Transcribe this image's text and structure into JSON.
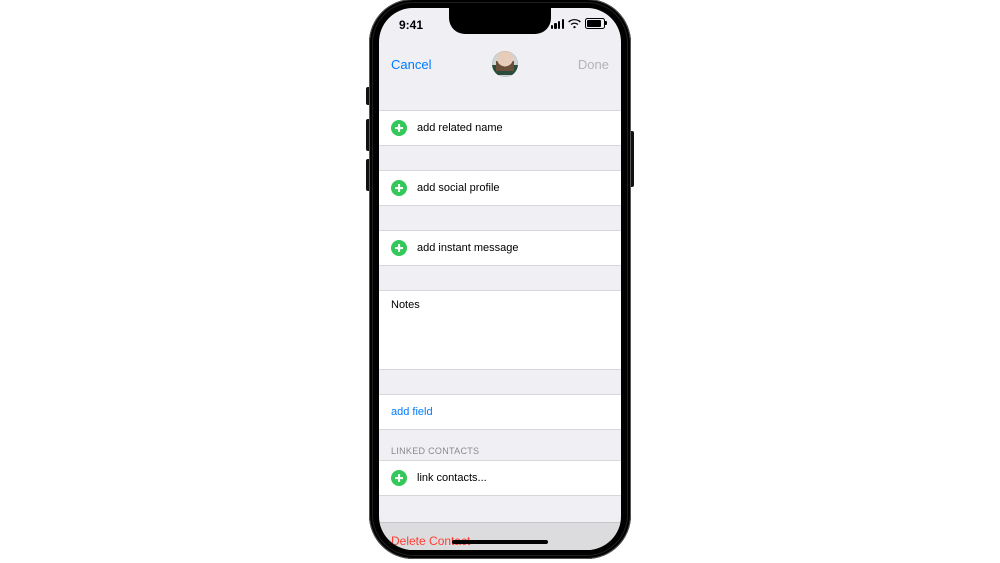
{
  "status": {
    "time": "9:41"
  },
  "nav": {
    "cancel": "Cancel",
    "done": "Done"
  },
  "rows": {
    "add_related_name": "add related name",
    "add_social_profile": "add social profile",
    "add_instant_message": "add instant message",
    "notes_label": "Notes",
    "add_field": "add field",
    "link_contacts": "link contacts..."
  },
  "sections": {
    "linked_contacts": "LINKED CONTACTS"
  },
  "delete_contact": "Delete Contact"
}
